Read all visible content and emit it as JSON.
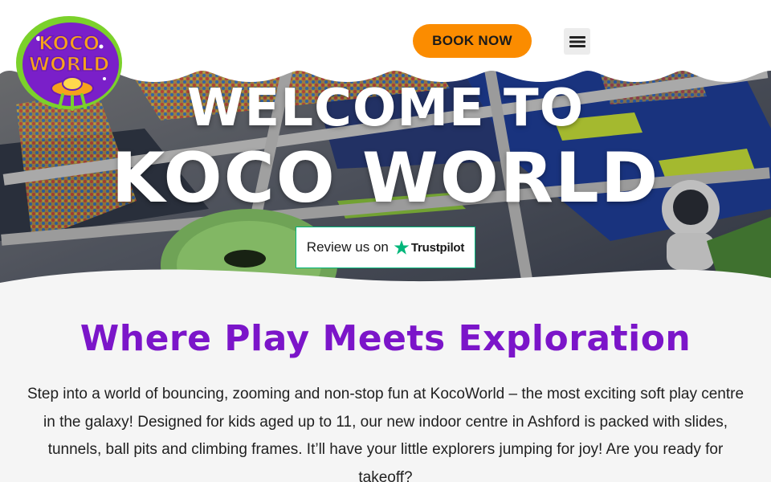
{
  "header": {
    "logo": {
      "text_line1": "KOCO",
      "text_line2": "WORLD",
      "icon": "ufo-logo-icon"
    },
    "book_label": "BOOK NOW",
    "menu_icon": "hamburger-menu-icon"
  },
  "hero": {
    "title_line1": "WELCOME TO",
    "title_line2": "KOCO WORLD",
    "review_label": "Review us on",
    "review_brand": "Trustpilot",
    "review_icon": "trustpilot-star-icon"
  },
  "intro": {
    "heading": "Where Play Meets Exploration",
    "body": "Step into a world of bouncing, zooming and non-stop fun at KocoWorld – the most exciting soft play centre in the galaxy! Designed for kids aged up to 11, our new indoor centre in Ashford is packed with slides, tunnels, ball pits and climbing frames. It’ll have your little explorers jumping for joy! Are you ready for takeoff?"
  },
  "colors": {
    "accent_orange": "#fb8c00",
    "heading_purple": "#7b15c9",
    "logo_green": "#7bd12b",
    "logo_purple": "#7a1fc9",
    "trustpilot_green": "#00b67a",
    "background": "#f5f5f5"
  }
}
